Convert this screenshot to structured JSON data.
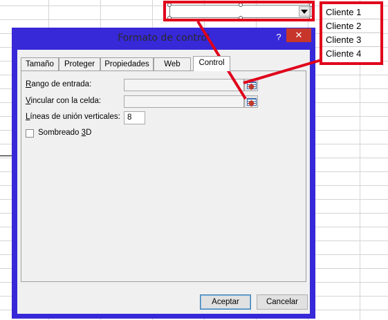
{
  "sheet": {
    "clients": [
      "Cliente 1",
      "Cliente 2",
      "Cliente 3",
      "Cliente 4"
    ]
  },
  "dialog": {
    "title": "Formato de control",
    "help_label": "?",
    "close_label": "✕",
    "tabs": [
      {
        "label": "Tamaño"
      },
      {
        "label": "Proteger"
      },
      {
        "label": "Propiedades"
      },
      {
        "label": "Web"
      },
      {
        "label": "Control"
      }
    ],
    "active_tab": "Control",
    "fields": {
      "input_range_label_u": "R",
      "input_range_label_rest": "ango de entrada:",
      "input_range_value": "",
      "cell_link_label_u": "V",
      "cell_link_label_rest": "incular con la celda:",
      "cell_link_value": "",
      "drop_lines_label_u": "L",
      "drop_lines_label_rest": "íneas de unión verticales:",
      "drop_lines_value": "8",
      "shading_label_pre": "Sombreado ",
      "shading_label_u": "3",
      "shading_label_post": "D",
      "shading_checked": false
    },
    "buttons": {
      "ok": "Aceptar",
      "cancel": "Cancelar"
    }
  },
  "colors": {
    "highlight": "#e0001b",
    "dialog_frame": "#3728d8",
    "close_button": "#c7362b"
  }
}
